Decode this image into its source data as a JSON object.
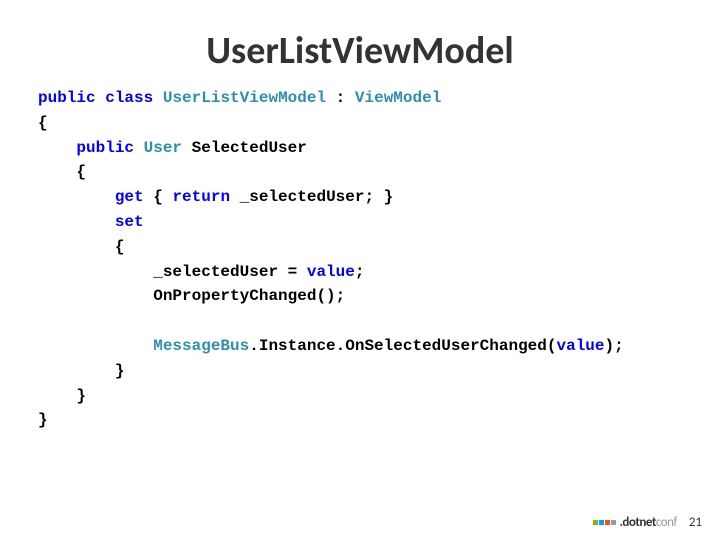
{
  "title": "UserListViewModel",
  "code": {
    "kw_public1": "public",
    "kw_class": "class",
    "type_ulvm": "UserListViewModel",
    "colon": " : ",
    "type_vm": "ViewModel",
    "brace_open1": "{",
    "kw_public2": "public",
    "type_user": "User",
    "prop_name": " SelectedUser",
    "prop_brace_open": "    {",
    "kw_get": "get",
    "get_body_open": " { ",
    "kw_return": "return",
    "get_body_close": " _selectedUser; }",
    "kw_set": "set",
    "set_brace_open": "        {",
    "set_line1": "            _selectedUser = ",
    "kw_value1": "value",
    "set_line1_end": ";",
    "set_line2": "            OnPropertyChanged();",
    "type_msgbus": "MessageBus",
    "set_line3_mid": ".Instance.OnSelectedUserChanged(",
    "kw_value2": "value",
    "set_line3_end": ");",
    "set_brace_close": "        }",
    "prop_brace_close": "    }",
    "brace_close1": "}"
  },
  "footer": {
    "brand": ".dotnet",
    "brand_suffix": "conf",
    "page_number": "21"
  }
}
